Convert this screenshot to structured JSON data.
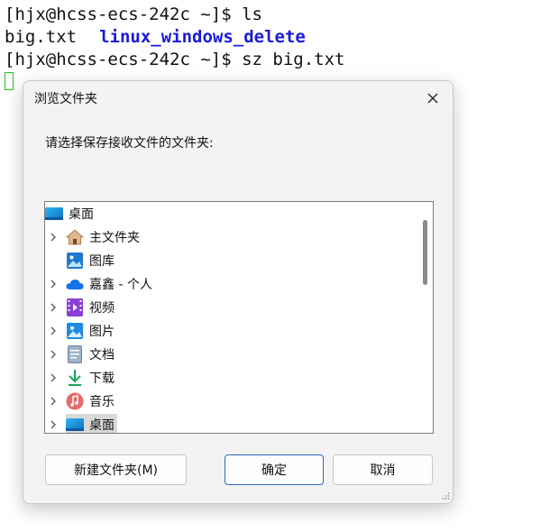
{
  "terminal": {
    "line1": "[hjx@hcss-ecs-242c ~]$ ls",
    "line2_file": "big.txt",
    "line2_dir": "linux_windows_delete",
    "line3": "[hjx@hcss-ecs-242c ~]$ sz big.txt"
  },
  "dialog": {
    "title": "浏览文件夹",
    "prompt": "请选择保存接收文件的文件夹:",
    "tree_items": [
      {
        "label": "桌面",
        "icon": "desktop-icon"
      },
      {
        "label": "主文件夹",
        "icon": "home-icon"
      },
      {
        "label": "图库",
        "icon": "gallery-icon"
      },
      {
        "label": "嘉鑫 - 个人",
        "icon": "onedrive-cloud-icon"
      },
      {
        "label": "视频",
        "icon": "videos-icon"
      },
      {
        "label": "图片",
        "icon": "pictures-icon"
      },
      {
        "label": "文档",
        "icon": "documents-icon"
      },
      {
        "label": "下载",
        "icon": "downloads-icon"
      },
      {
        "label": "音乐",
        "icon": "music-icon"
      },
      {
        "label": "桌面",
        "icon": "desktop-icon"
      }
    ],
    "buttons": {
      "new_folder": "新建文件夹(M)",
      "ok": "确定",
      "cancel": "取消"
    }
  },
  "colors": {
    "dir_blue": "#1a1adc",
    "cursor_green": "#22c322",
    "ok_border": "#2a66c4"
  }
}
